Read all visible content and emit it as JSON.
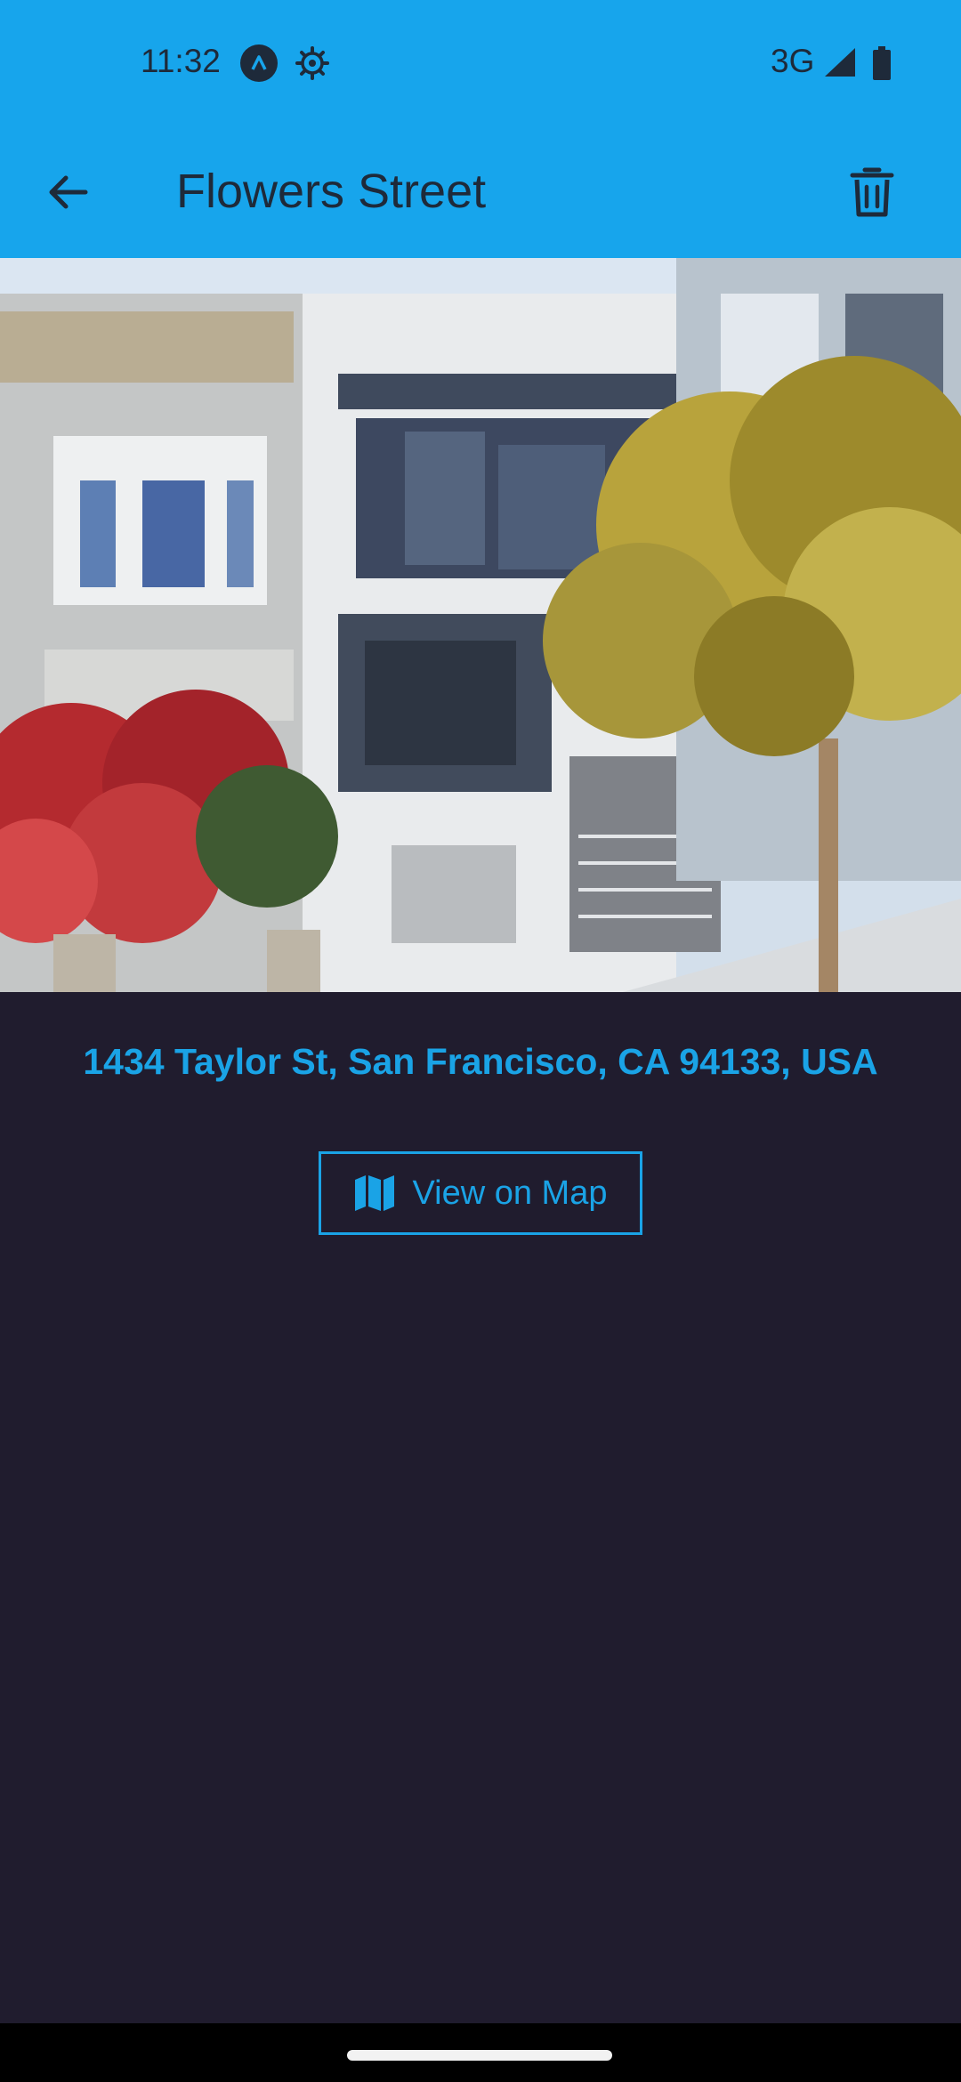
{
  "status_bar": {
    "time": "11:32",
    "network": "3G",
    "icons": [
      "app-notification-icon",
      "gear-icon",
      "cell-signal-icon",
      "battery-icon"
    ]
  },
  "app_bar": {
    "title": "Flowers Street",
    "back_icon": "arrow-left-icon",
    "delete_icon": "trash-icon"
  },
  "place": {
    "address": "1434 Taylor St, San Francisco, CA 94133, USA",
    "map_button_label": "View on Map",
    "map_icon": "map-icon"
  },
  "colors": {
    "app_bar": "#17a5ec",
    "background": "#201c2e",
    "accent": "#1aa3e6"
  }
}
